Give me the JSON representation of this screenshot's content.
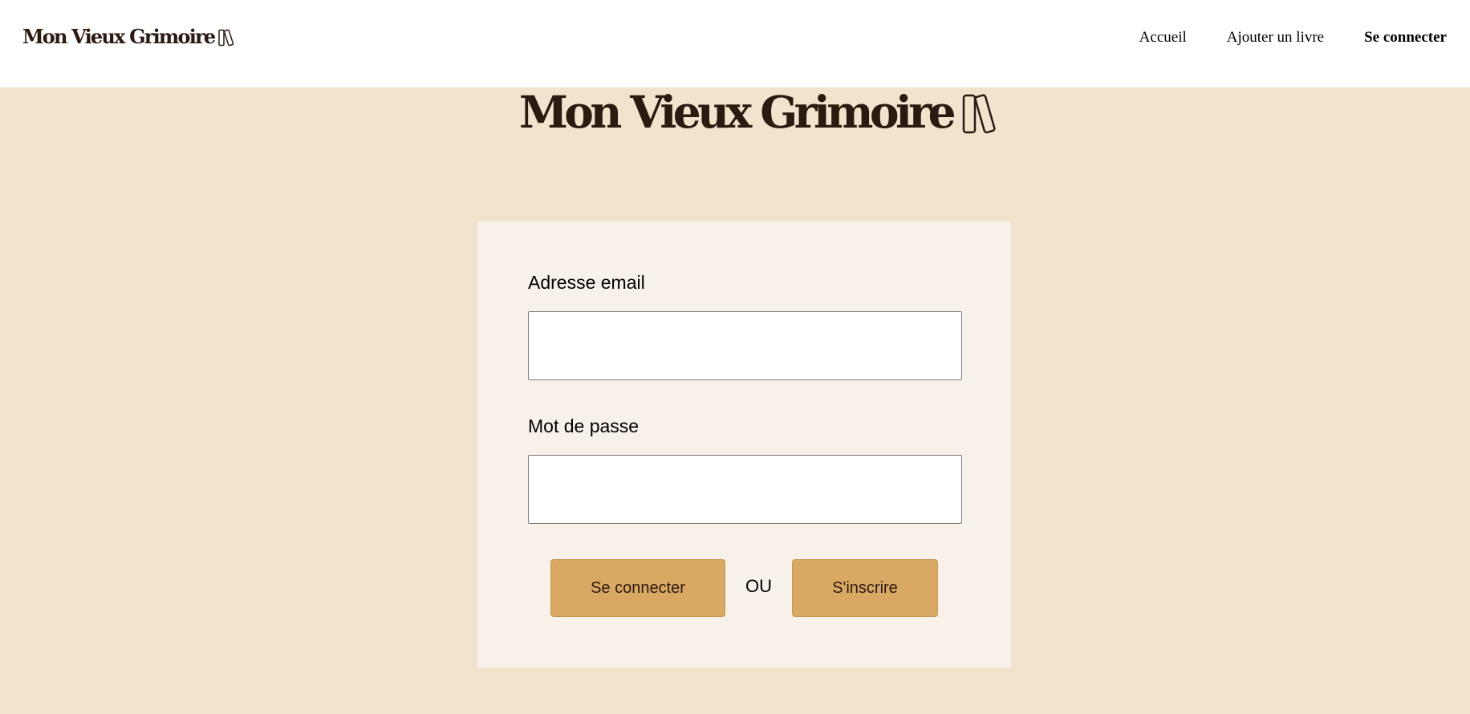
{
  "header": {
    "brand": "Mon Vieux Grimoire",
    "brand_icon": "books-icon",
    "nav": [
      {
        "label": "Accueil",
        "active": false
      },
      {
        "label": "Ajouter un livre",
        "active": false
      },
      {
        "label": "Se connecter",
        "active": true
      }
    ]
  },
  "hero": {
    "title": "Mon Vieux Grimoire",
    "icon": "books-icon"
  },
  "login_form": {
    "email_label": "Adresse email",
    "email_value": "",
    "email_placeholder": "",
    "password_label": "Mot de passe",
    "password_value": "",
    "password_placeholder": "",
    "login_button": "Se connecter",
    "separator": "OU",
    "register_button": "S'inscrire"
  },
  "colors": {
    "page_background": "#f2e3cd",
    "header_background": "#ffffff",
    "card_background": "#f7f1ea",
    "button_background": "#d9a862",
    "brand_text": "#2b1a10"
  }
}
